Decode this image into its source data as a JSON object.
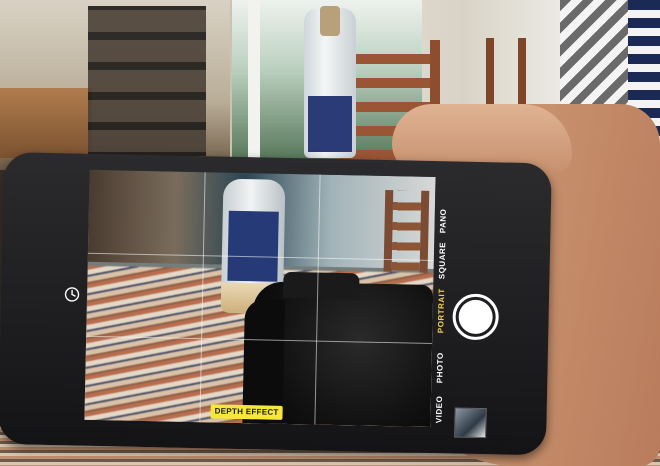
{
  "camera_ui": {
    "modes": {
      "video": "VIDEO",
      "photo": "PHOTO",
      "portrait": "PORTRAIT",
      "square": "SQUARE",
      "pano": "PANO"
    },
    "active_mode": "PORTRAIT",
    "depth_effect_label": "DEPTH EFFECT",
    "accent_color": "#f4d14a",
    "badge_color": "#f7e73a",
    "icons": [
      "timer-icon",
      "shutter-button",
      "last-photo-thumbnail"
    ]
  }
}
